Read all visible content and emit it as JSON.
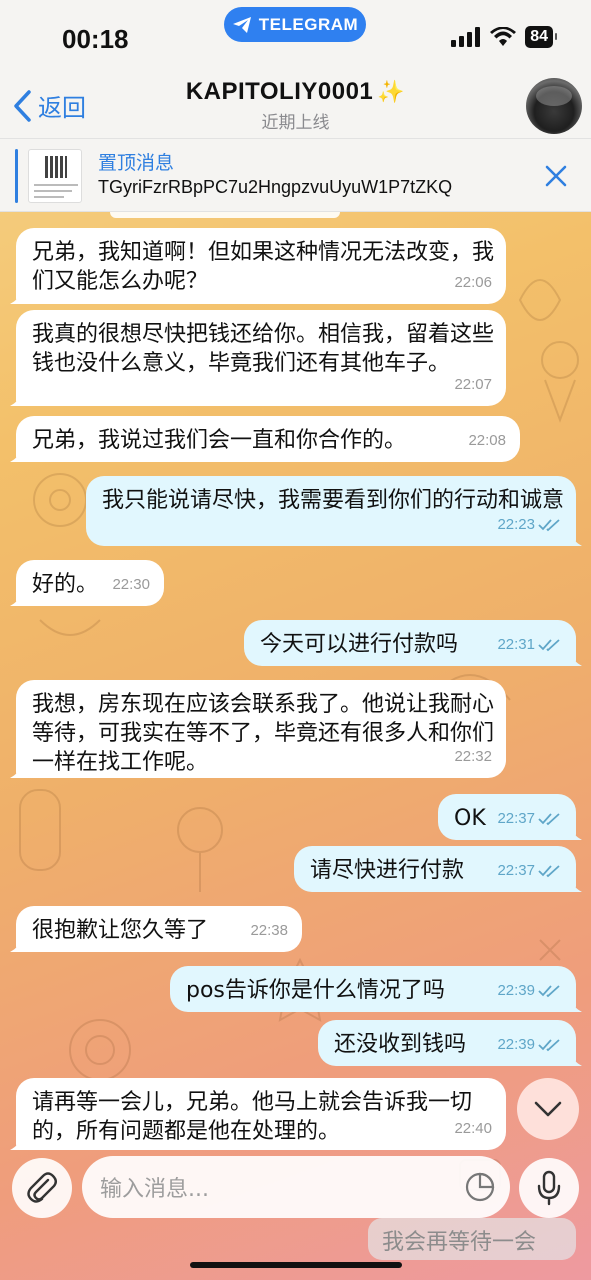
{
  "status_bar": {
    "time": "00:18",
    "app_pill": "TELEGRAM",
    "battery": "84"
  },
  "header": {
    "back_label": "返回",
    "title": "KAPITOLIY0001",
    "subtitle": "近期上线"
  },
  "pinned": {
    "title": "置顶消息",
    "text": "TGyriFzrRBpPC7u2HngpzvuUyuW1P7tZKQ"
  },
  "messages": [
    {
      "dir": "in",
      "text": "兄弟，我知道啊！但如果这种情况无法改变，我们又能怎么办呢？",
      "time": "22:06"
    },
    {
      "dir": "in",
      "text": "我真的很想尽快把钱还给你。相信我，留着这些钱也没什么意义，毕竟我们还有其他车子。",
      "time": "22:07"
    },
    {
      "dir": "in",
      "text": "兄弟，我说过我们会一直和你合作的。",
      "time": "22:08"
    },
    {
      "dir": "out",
      "text": "我只能说请尽快，我需要看到你们的行动和诚意",
      "time": "22:23"
    },
    {
      "dir": "in",
      "text": "好的。",
      "time": "22:30"
    },
    {
      "dir": "out",
      "text": "今天可以进行付款吗",
      "time": "22:31"
    },
    {
      "dir": "in",
      "text": "我想，房东现在应该会联系我了。他说让我耐心等待，可我实在等不了，毕竟还有很多人和你们一样在找工作呢。",
      "time": "22:32"
    },
    {
      "dir": "out",
      "text": "OK",
      "time": "22:37"
    },
    {
      "dir": "out",
      "text": "请尽快进行付款",
      "time": "22:37"
    },
    {
      "dir": "in",
      "text": "很抱歉让您久等了",
      "time": "22:38"
    },
    {
      "dir": "out",
      "text": "pos告诉你是什么情况了吗",
      "time": "22:39"
    },
    {
      "dir": "out",
      "text": "还没收到钱吗",
      "time": "22:39"
    },
    {
      "dir": "in",
      "text": "请再等一会儿，兄弟。他马上就会告诉我一切的，所有问题都是他在处理的。",
      "time": "22:40"
    }
  ],
  "composer": {
    "placeholder": "输入消息..."
  },
  "ghost_message": "我会再等待一会",
  "colors": {
    "accent": "#2f7fe0",
    "incoming_bubble": "#ffffff",
    "outgoing_bubble": "#e1f7fe",
    "read_check": "#5fa6c8"
  }
}
